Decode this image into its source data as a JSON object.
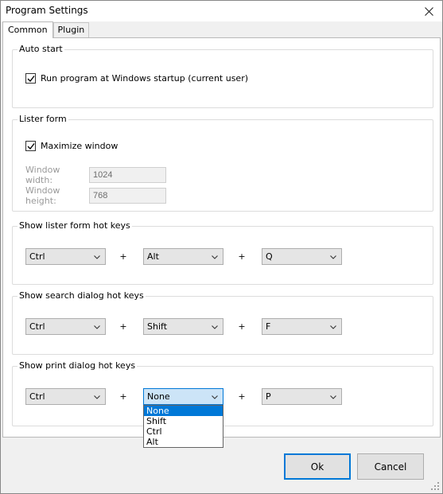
{
  "window": {
    "title": "Program Settings"
  },
  "tabs": [
    {
      "label": "Common",
      "active": true
    },
    {
      "label": "Plugin",
      "active": false
    }
  ],
  "auto_start": {
    "title": "Auto start",
    "run_at_startup": {
      "label": "Run program at Windows startup (current user)",
      "checked": true
    }
  },
  "lister_form": {
    "title": "Lister form",
    "maximize_window": {
      "label": "Maximize window",
      "checked": true
    },
    "window_width": {
      "label": "Window width:",
      "value": "1024"
    },
    "window_height": {
      "label": "Window height:",
      "value": "768"
    }
  },
  "hotkey_groups": [
    {
      "title": "Show lister form hot keys",
      "modifier1": "Ctrl",
      "modifier2": "Alt",
      "key": "Q"
    },
    {
      "title": "Show search dialog hot keys",
      "modifier1": "Ctrl",
      "modifier2": "Shift",
      "key": "F"
    },
    {
      "title": "Show print dialog hot keys",
      "modifier1": "Ctrl",
      "modifier2": "None",
      "key": "P"
    }
  ],
  "plus_sign": "+",
  "open_dropdown": {
    "options": [
      "None",
      "Shift",
      "Ctrl",
      "Alt"
    ],
    "selected": "None"
  },
  "buttons": {
    "ok": "Ok",
    "cancel": "Cancel"
  },
  "colors": {
    "accent": "#0078d7",
    "selection_bg": "#cce4f7"
  }
}
